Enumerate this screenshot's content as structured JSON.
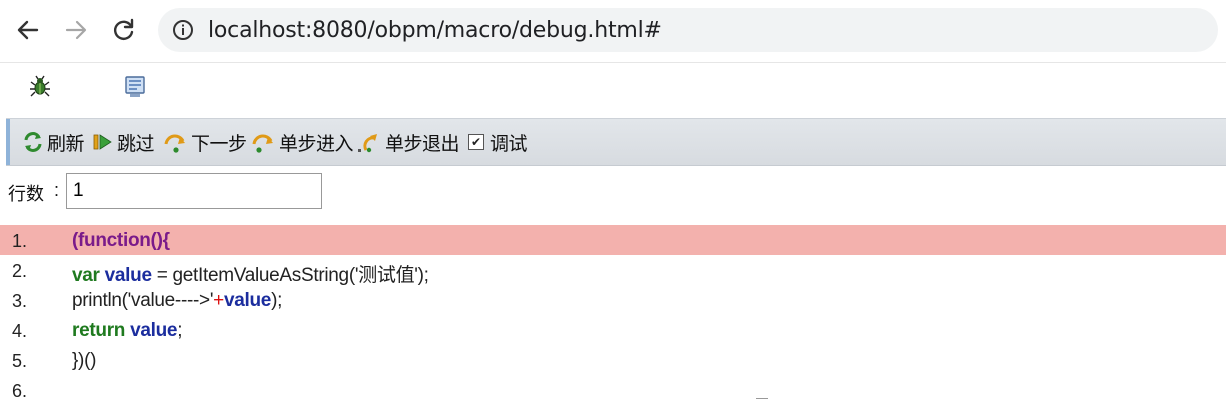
{
  "browser": {
    "url": "localhost:8080/obpm/macro/debug.html#"
  },
  "toolbar": {
    "refresh_label": "刷新",
    "skip_label": "跳过",
    "next_label": "下一步",
    "step_in_label": "单步进入",
    "step_out_label": "单步退出",
    "debug_label": "调试",
    "debug_checked": true
  },
  "line_field": {
    "label": "行数",
    "colon": ":",
    "value": "1"
  },
  "code": {
    "current_line": 1,
    "line_numbers": [
      "1.",
      "2.",
      "3.",
      "4.",
      "5.",
      "6."
    ],
    "lines": [
      {
        "parts": [
          "(function(){"
        ]
      },
      {
        "parts": [
          "var",
          " ",
          "value",
          " = getItemValueAsString('",
          "测试值",
          "');"
        ]
      },
      {
        "parts": [
          "println('value---->'",
          "+",
          "value",
          ");"
        ]
      },
      {
        "parts": [
          "return",
          " ",
          "value",
          ";"
        ]
      },
      {
        "parts": [
          "})()"
        ]
      },
      {
        "parts": [
          ""
        ]
      }
    ]
  },
  "colors": {
    "current_line_bg": "#f3b1ad",
    "keyword_function": "#7a1b8a",
    "keyword_var": "#1f7a1f",
    "variable": "#1b2d9e",
    "toolbar_bg": "#dde1e6"
  },
  "icons": {
    "back": "arrow-left-icon",
    "forward": "arrow-right-icon",
    "reload": "reload-icon",
    "info": "info-icon",
    "bug": "bug-icon",
    "monitor": "monitor-icon",
    "refresh": "refresh-icon",
    "skip": "skip-icon",
    "next": "step-over-icon",
    "step_in": "step-into-icon",
    "step_out": "step-out-icon"
  }
}
